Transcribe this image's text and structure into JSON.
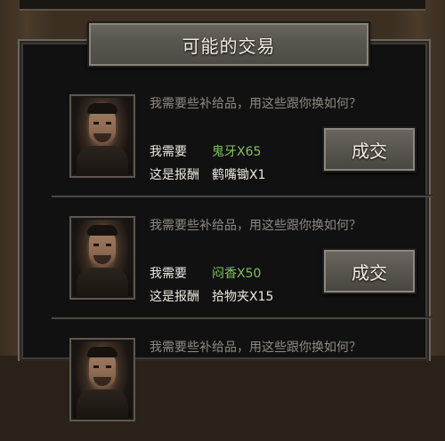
{
  "title": "可能的交易",
  "need_label": "我需要",
  "reward_label": "这是报酬",
  "button_label": "成交",
  "offers": [
    {
      "message": "我需要些补给品，用这些跟你换如何？",
      "need": "鬼牙X65",
      "reward": "鹤嘴锄X1"
    },
    {
      "message": "我需要些补给品，用这些跟你换如何？",
      "need": "闷香X50",
      "reward": "拾物夹X15"
    },
    {
      "message": "我需要些补给品，用这些跟你换如何？"
    }
  ],
  "colors": {
    "need_highlight": "#7ec25a",
    "text_primary": "#ece8df",
    "text_muted": "#8f8a82"
  }
}
